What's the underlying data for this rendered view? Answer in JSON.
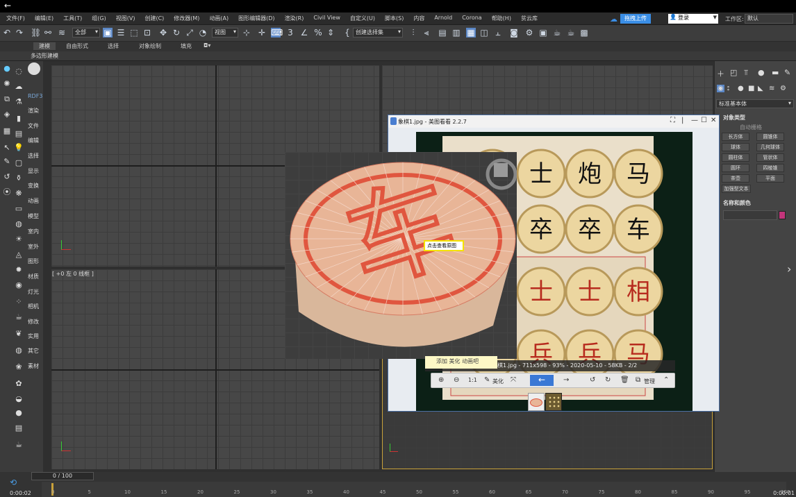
{
  "topbar": {
    "back_icon": "←"
  },
  "menubar": {
    "items": [
      "文件(F)",
      "编辑(E)",
      "工具(T)",
      "组(G)",
      "视图(V)",
      "创建(C)",
      "修改器(M)",
      "动画(A)",
      "图形编辑器(D)",
      "渲染(R)",
      "Civil View",
      "自定义(U)",
      "脚本(S)",
      "内容",
      "Arnold",
      "Corona",
      "帮助(H)",
      "贫云库"
    ],
    "upload_label": "拖拽上传",
    "account_label": "登录",
    "workspace_label": "工作区:",
    "workspace_value": "默认"
  },
  "toolbar": {
    "selection_filter": "全部",
    "ref_coord": "视图",
    "named_selection": "创建选择集"
  },
  "ribbon": {
    "tabs": [
      "建模",
      "自由形式",
      "选择",
      "对象绘制",
      "填充"
    ],
    "sub_label": "多边形建模"
  },
  "tool_labels": [
    "RDF3",
    "渲染",
    "文件",
    "编辑",
    "选择",
    "显示",
    "变换",
    "动画",
    "模型",
    "室内",
    "室外",
    "图形",
    "材质",
    "灯光",
    "相机",
    "修改",
    "实用",
    "其它",
    "素材"
  ],
  "viewport": {
    "label": "[ +0 左 0 线框 ]"
  },
  "right_panel": {
    "category": "标准基本体",
    "object_type_title": "对象类型",
    "auto_grid": "自动栅格",
    "buttons": [
      "长方体",
      "圆锥体",
      "球体",
      "几何球体",
      "圆柱体",
      "管状体",
      "圆环",
      "四棱锥",
      "茶壶",
      "平面"
    ],
    "extended_text": "加强型文本",
    "name_color_title": "名称和颜色",
    "swatch_color": "#c3357b"
  },
  "viewer": {
    "title": "象棋1.jpg - 美图看看 2.2.7",
    "info": "象棋1.jpg - 711x598 - 93% - 2020-05-10 - 58KB - 2/2",
    "bubble": "添加  美化  动画吧",
    "toolbar": {
      "beautify": "美化",
      "manage": "管理",
      "ratio": "1:1"
    }
  },
  "tooltip": "点击查看原图",
  "chess_pieces": [
    "士",
    "炮",
    "马",
    "卒",
    "卒",
    "车",
    "士",
    "士",
    "相",
    "兵",
    "兵",
    "马",
    "马"
  ],
  "piece_character": "车",
  "timeline": {
    "frame": "0 / 100",
    "time_start": "0:00:02",
    "time_end": "0:00:01",
    "ticks": [
      "0",
      "5",
      "10",
      "15",
      "20",
      "25",
      "30",
      "35",
      "40",
      "45",
      "50",
      "55",
      "60",
      "65",
      "70",
      "75",
      "80",
      "85",
      "90",
      "95",
      "100"
    ]
  }
}
